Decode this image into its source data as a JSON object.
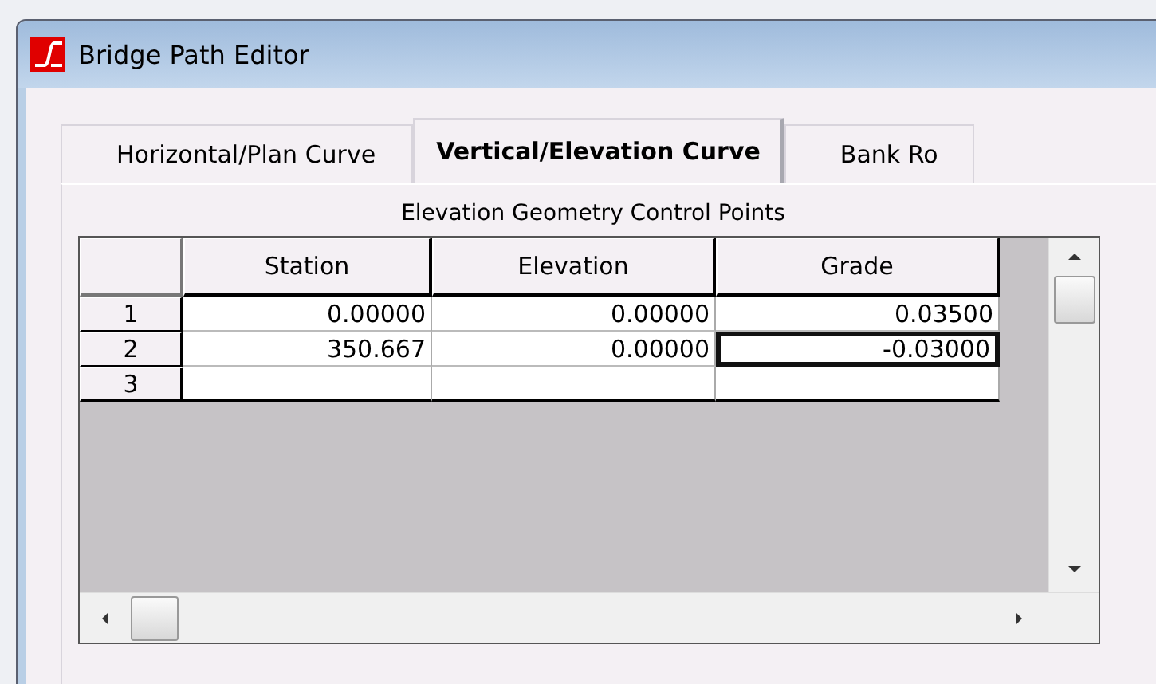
{
  "window": {
    "title": "Bridge Path Editor"
  },
  "tabs": [
    {
      "label": "Horizontal/Plan Curve",
      "selected": false
    },
    {
      "label": "Vertical/Elevation Curve",
      "selected": true
    },
    {
      "label": "Bank Ro",
      "selected": false
    }
  ],
  "grid": {
    "caption": "Elevation Geometry Control Points",
    "columns": [
      "Station",
      "Elevation",
      "Grade"
    ],
    "rows": [
      {
        "header": "1",
        "cells": [
          {
            "text": "0.00000",
            "selected": false
          },
          {
            "text": "0.00000",
            "selected": false
          },
          {
            "text": "0.03500",
            "selected": false
          }
        ]
      },
      {
        "header": "2",
        "cells": [
          {
            "text": "350.667",
            "selected": false
          },
          {
            "text": "0.00000",
            "selected": false
          },
          {
            "text": "-0.03000",
            "selected": true
          }
        ]
      },
      {
        "header": "3",
        "cells": []
      }
    ]
  }
}
